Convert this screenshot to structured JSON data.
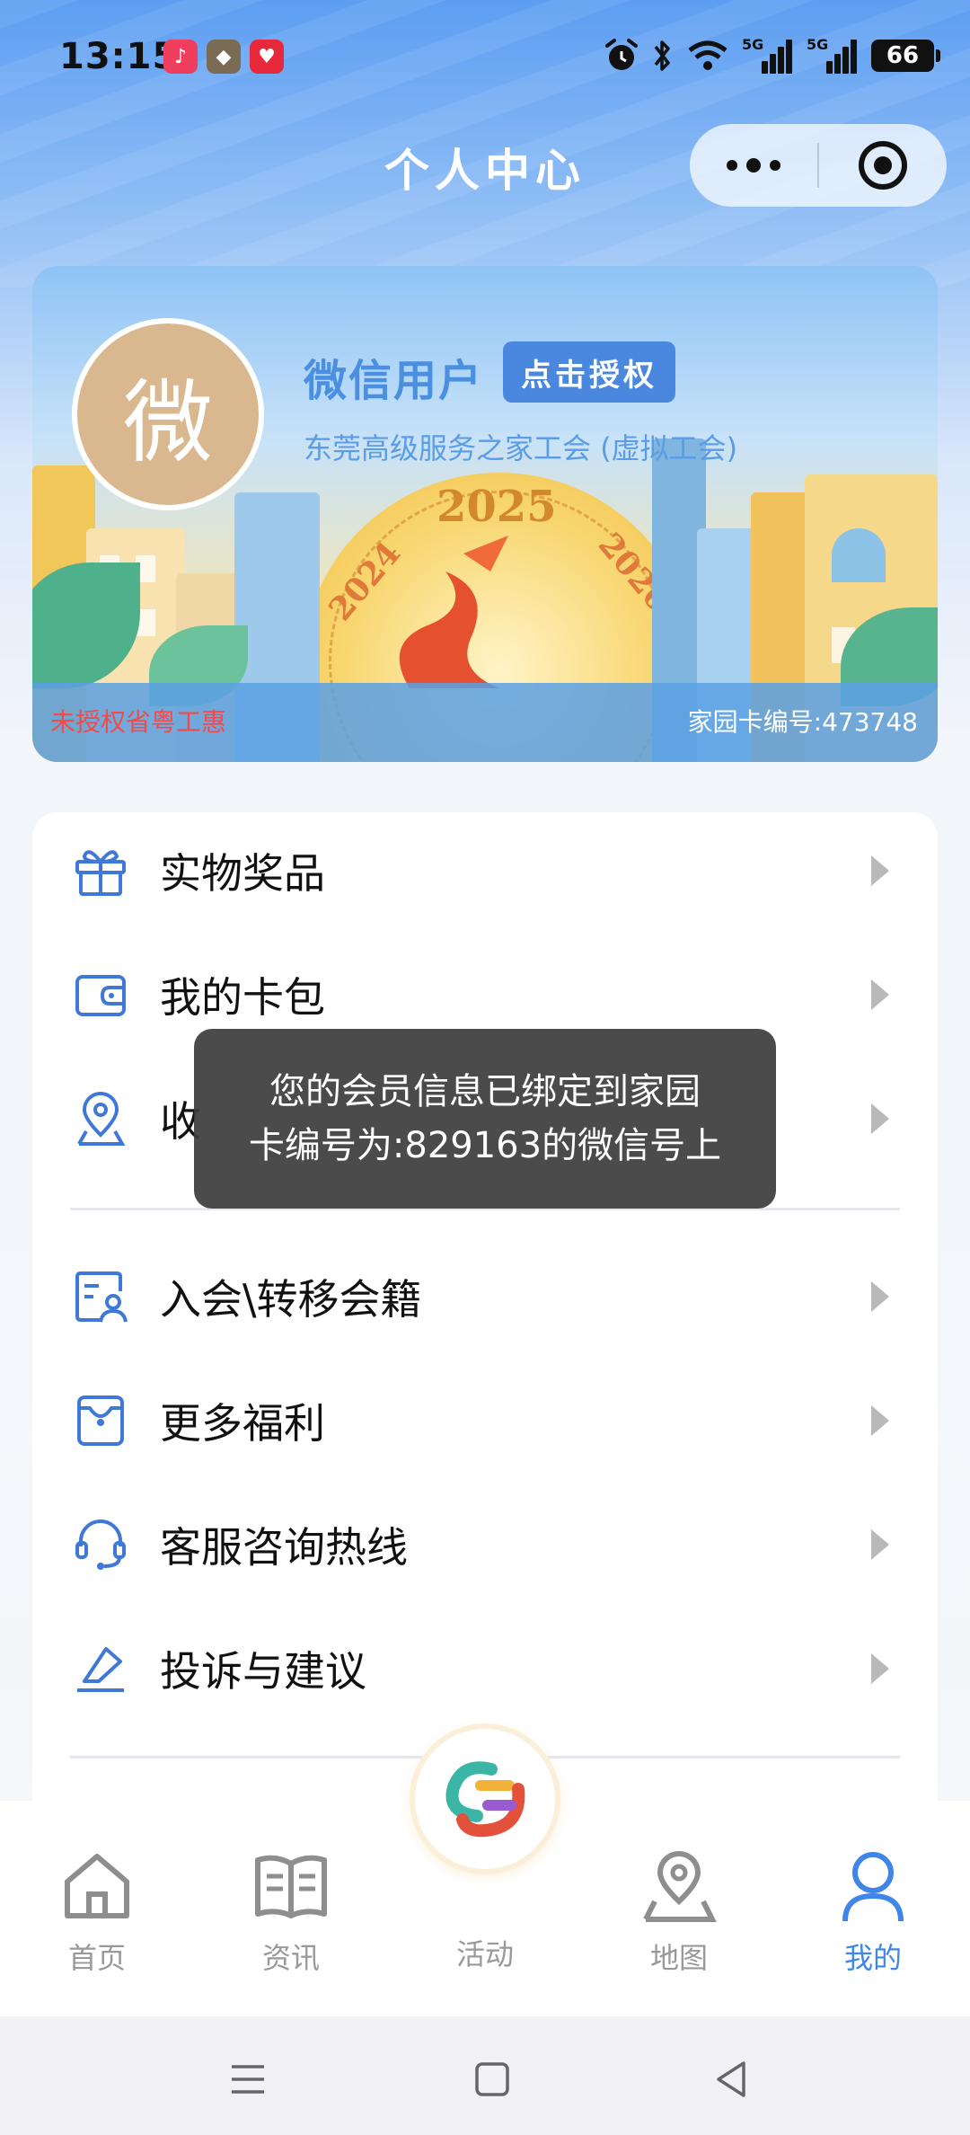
{
  "status_bar": {
    "time": "13:15",
    "network_1": "5G",
    "network_2": "5G",
    "battery": "66"
  },
  "header": {
    "title": "个人中心"
  },
  "banner": {
    "avatar_char": "微",
    "user_name": "微信用户",
    "auth_button": "点击授权",
    "union_name": "东莞高级服务之家工会 (虚拟工会)",
    "status": "未授权省粤工惠",
    "card_number": "家园卡编号:473748",
    "art_year": "2025",
    "art_year_left": "2024",
    "art_year_right": "2026"
  },
  "menu": {
    "items": [
      {
        "label": "实物奖品",
        "icon": "gift-icon"
      },
      {
        "label": "我的卡包",
        "icon": "wallet-icon"
      },
      {
        "label": "收",
        "icon": "location-icon"
      },
      {
        "label": "入会\\转移会籍",
        "icon": "membership-icon"
      },
      {
        "label": "更多福利",
        "icon": "welfare-icon"
      },
      {
        "label": "客服咨询热线",
        "icon": "headset-icon"
      },
      {
        "label": "投诉与建议",
        "icon": "complaint-icon"
      }
    ]
  },
  "toast": {
    "line1": "您的会员信息已绑定到家园",
    "line2": "卡编号为:829163的微信号上"
  },
  "tabbar": {
    "tabs": [
      {
        "label": "首页",
        "icon": "home-icon"
      },
      {
        "label": "资讯",
        "icon": "book-icon"
      },
      {
        "label": "活动",
        "icon": "activity-logo-icon"
      },
      {
        "label": "地图",
        "icon": "map-pin-icon"
      },
      {
        "label": "我的",
        "icon": "user-icon",
        "active": true
      }
    ]
  },
  "colors": {
    "accent": "#3f86e8",
    "toast_bg": "#3c3c3c",
    "alert_text": "#f04a4a"
  }
}
